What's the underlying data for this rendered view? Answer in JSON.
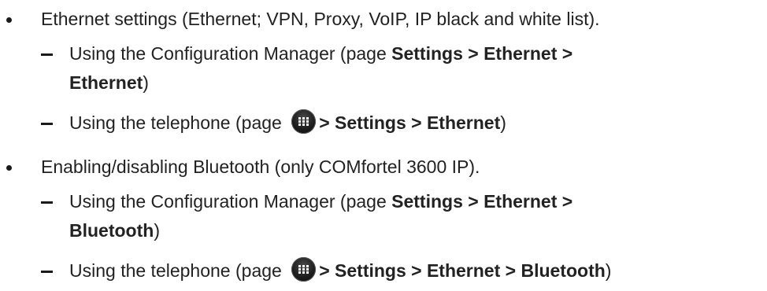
{
  "items": [
    {
      "text": "Ethernet settings (Ethernet; VPN, Proxy, VoIP, IP black and white list).",
      "subitems": [
        {
          "line1_prefix": "Using the Configuration Manager (page ",
          "line1_bold": "Settings > Ethernet >",
          "line2_bold": "Ethernet",
          "line2_suffix": ")"
        },
        {
          "prefix": "Using the telephone (page ",
          "icon": "app-menu-icon",
          "bold": "> Settings > Ethernet",
          "suffix": ")"
        }
      ]
    },
    {
      "text": "Enabling/disabling Bluetooth (only COMfortel 3600 IP).",
      "subitems": [
        {
          "line1_prefix": "Using the Configuration Manager (page ",
          "line1_bold": "Settings > Ethernet >",
          "line2_bold": "Bluetooth",
          "line2_suffix": ")"
        },
        {
          "prefix": "Using the telephone (page ",
          "icon": "app-menu-icon",
          "bold": "> Settings > Ethernet > Bluetooth",
          "suffix": ")"
        }
      ]
    }
  ]
}
